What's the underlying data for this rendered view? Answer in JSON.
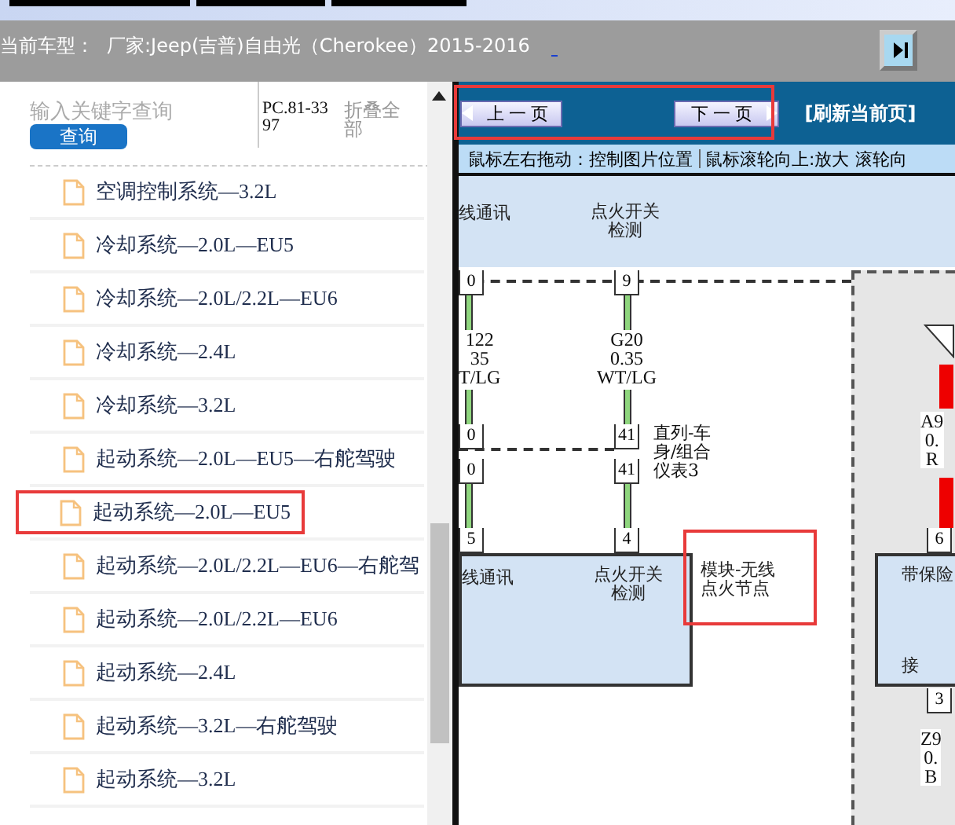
{
  "top_bar": {
    "vehicle_label": "当前车型：",
    "vehicle": "厂家:Jeep(吉普)自由光（Cherokee）2015-2016"
  },
  "search": {
    "placeholder": "输入关键字查询",
    "button": "查询",
    "code": "PC.81-3397",
    "collapse": "折叠全部"
  },
  "items": [
    {
      "label": "空调控制系统—3.2L",
      "annotated": false
    },
    {
      "label": "冷却系统—2.0L—EU5",
      "annotated": false
    },
    {
      "label": "冷却系统—2.0L/2.2L—EU6",
      "annotated": false
    },
    {
      "label": "冷却系统—2.4L",
      "annotated": false
    },
    {
      "label": "冷却系统—3.2L",
      "annotated": false
    },
    {
      "label": "起动系统—2.0L—EU5—右舵驾驶",
      "annotated": false
    },
    {
      "label": "起动系统—2.0L—EU5",
      "annotated": true
    },
    {
      "label": "起动系统—2.0L/2.2L—EU6—右舵驾",
      "annotated": false
    },
    {
      "label": "起动系统—2.0L/2.2L—EU6",
      "annotated": false
    },
    {
      "label": "起动系统—2.4L",
      "annotated": false
    },
    {
      "label": "起动系统—3.2L—右舵驾驶",
      "annotated": false
    },
    {
      "label": "起动系统—3.2L",
      "annotated": false
    }
  ],
  "viewer": {
    "prev": "上 一 页",
    "next": "下 一 页",
    "refresh": "[刷新当前页]",
    "nav_annotated": true,
    "hints": [
      "鼠标左右拖动：控制图片位置",
      "鼠标滚轮向上:放大",
      "滚轮向"
    ]
  },
  "diagram": {
    "header_labels": [
      [
        "线通讯"
      ],
      [
        "点火开关",
        "检测"
      ]
    ],
    "pins": [
      "0",
      "9",
      "0",
      "41",
      "0",
      "41",
      "5",
      "4",
      "6",
      "3"
    ],
    "wire_labels": [
      "122\n35\nT/LG",
      "G20\n0.35\nWT/LG",
      "A9\n0.\nR",
      "Z9\n0.\nB"
    ],
    "connector_label": [
      "直列-车",
      "身/组合",
      "仪表3"
    ],
    "module_labels": [
      [
        "线通讯"
      ],
      [
        "点火开关",
        "检测"
      ],
      [
        "带保险"
      ],
      [
        "接"
      ]
    ],
    "callout": {
      "text": [
        "模块-无线",
        "点火节点"
      ],
      "annotated": true
    }
  }
}
